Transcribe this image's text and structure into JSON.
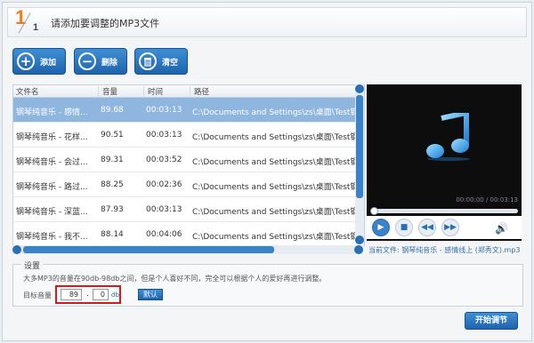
{
  "header": {
    "step_number": "1",
    "step_total": "1",
    "title": "请添加要调整的MP3文件"
  },
  "toolbar": {
    "add_label": "添加",
    "remove_label": "删除",
    "clear_label": "清空"
  },
  "table": {
    "columns": [
      "文件名",
      "音量",
      "时间",
      "路径"
    ],
    "rows": [
      {
        "name": "钢琴纯音乐 - 感情...",
        "volume": "89.68",
        "time": "00:03:13",
        "path": "C:\\Documents and Settings\\zs\\桌面\\Test钢",
        "selected": true
      },
      {
        "name": "钢琴纯音乐 - 花样...",
        "volume": "90.51",
        "time": "00:03:13",
        "path": "C:\\Documents and Settings\\zs\\桌面\\Test钢",
        "selected": false
      },
      {
        "name": "钢琴纯音乐 - 会过...",
        "volume": "89.31",
        "time": "00:03:52",
        "path": "C:\\Documents and Settings\\zs\\桌面\\Test钢",
        "selected": false
      },
      {
        "name": "钢琴纯音乐 - 路过...",
        "volume": "88.25",
        "time": "00:02:36",
        "path": "C:\\Documents and Settings\\zs\\桌面\\Test钢",
        "selected": false
      },
      {
        "name": "钢琴纯音乐 - 深蓝...",
        "volume": "87.93",
        "time": "00:03:13",
        "path": "C:\\Documents and Settings\\zs\\桌面\\Test钢",
        "selected": false
      },
      {
        "name": "钢琴纯音乐 - 我不...",
        "volume": "88.14",
        "time": "00:04:06",
        "path": "C:\\Documents and Settings\\zs\\桌面\\Test钢",
        "selected": false
      }
    ]
  },
  "player": {
    "time": "00:00:00 / 00:03:13",
    "progress": 0,
    "current_file": "当前文件: 钢琴纯音乐 - 感情线上 (郑秀文).mp3",
    "icons": [
      "music-note-icon",
      "play-icon",
      "stop-icon",
      "previous-icon",
      "next-icon",
      "volume-icon"
    ]
  },
  "settings": {
    "legend": "设置",
    "description": "大多MP3的音量在90db-98db之间，但是个人喜好不同，完全可以根据个人的爱好再进行调整。",
    "target_label": "目标音量",
    "target_integer": "89",
    "separator": ".",
    "target_fraction": "0",
    "unit": "db",
    "default_label": "默认"
  },
  "actions": {
    "start_label": "开始调节"
  },
  "colors": {
    "accent": "#2a6eb6",
    "selected_row": "#8fb6de",
    "highlight_box": "#d51a1a",
    "step_orange": "#f07d1a"
  }
}
